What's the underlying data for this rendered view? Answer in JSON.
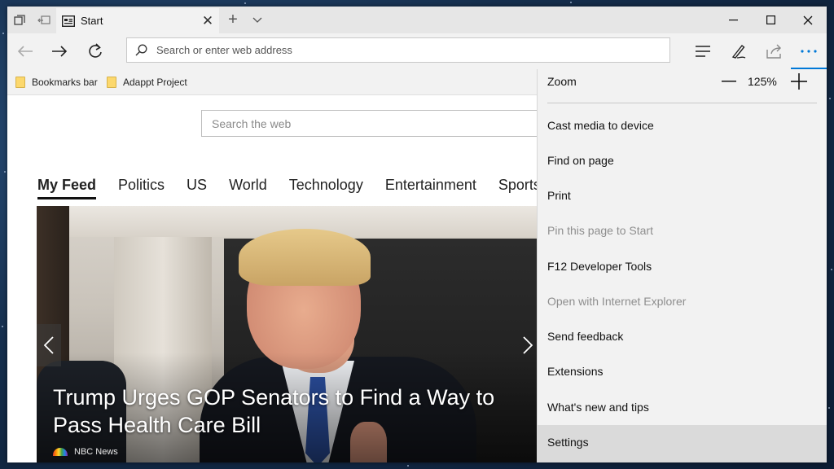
{
  "tab": {
    "title": "Start"
  },
  "address": {
    "placeholder": "Search or enter web address"
  },
  "favorites": [
    {
      "label": "Bookmarks bar"
    },
    {
      "label": "Adappt Project"
    }
  ],
  "content": {
    "search_placeholder": "Search the web",
    "feed_tabs": [
      "My Feed",
      "Politics",
      "US",
      "World",
      "Technology",
      "Entertainment",
      "Sports"
    ],
    "active_tab": "My Feed",
    "headline": "Trump Urges GOP Senators to Find a Way to Pass Health Care Bill",
    "source": "NBC News"
  },
  "menu": {
    "zoom_label": "Zoom",
    "zoom_value": "125%",
    "items": [
      {
        "label": "Cast media to device",
        "disabled": false
      },
      {
        "label": "Find on page",
        "disabled": false
      },
      {
        "label": "Print",
        "disabled": false
      },
      {
        "label": "Pin this page to Start",
        "disabled": true
      },
      {
        "label": "F12 Developer Tools",
        "disabled": false
      },
      {
        "label": "Open with Internet Explorer",
        "disabled": true
      },
      {
        "label": "Send feedback",
        "disabled": false
      },
      {
        "label": "Extensions",
        "disabled": false
      },
      {
        "label": "What's new and tips",
        "disabled": false
      },
      {
        "label": "Settings",
        "disabled": false,
        "hover": true
      }
    ]
  },
  "colors": {
    "accent": "#0078d7",
    "chrome": "#f2f2f2",
    "titlebar": "#e6e6e6"
  }
}
